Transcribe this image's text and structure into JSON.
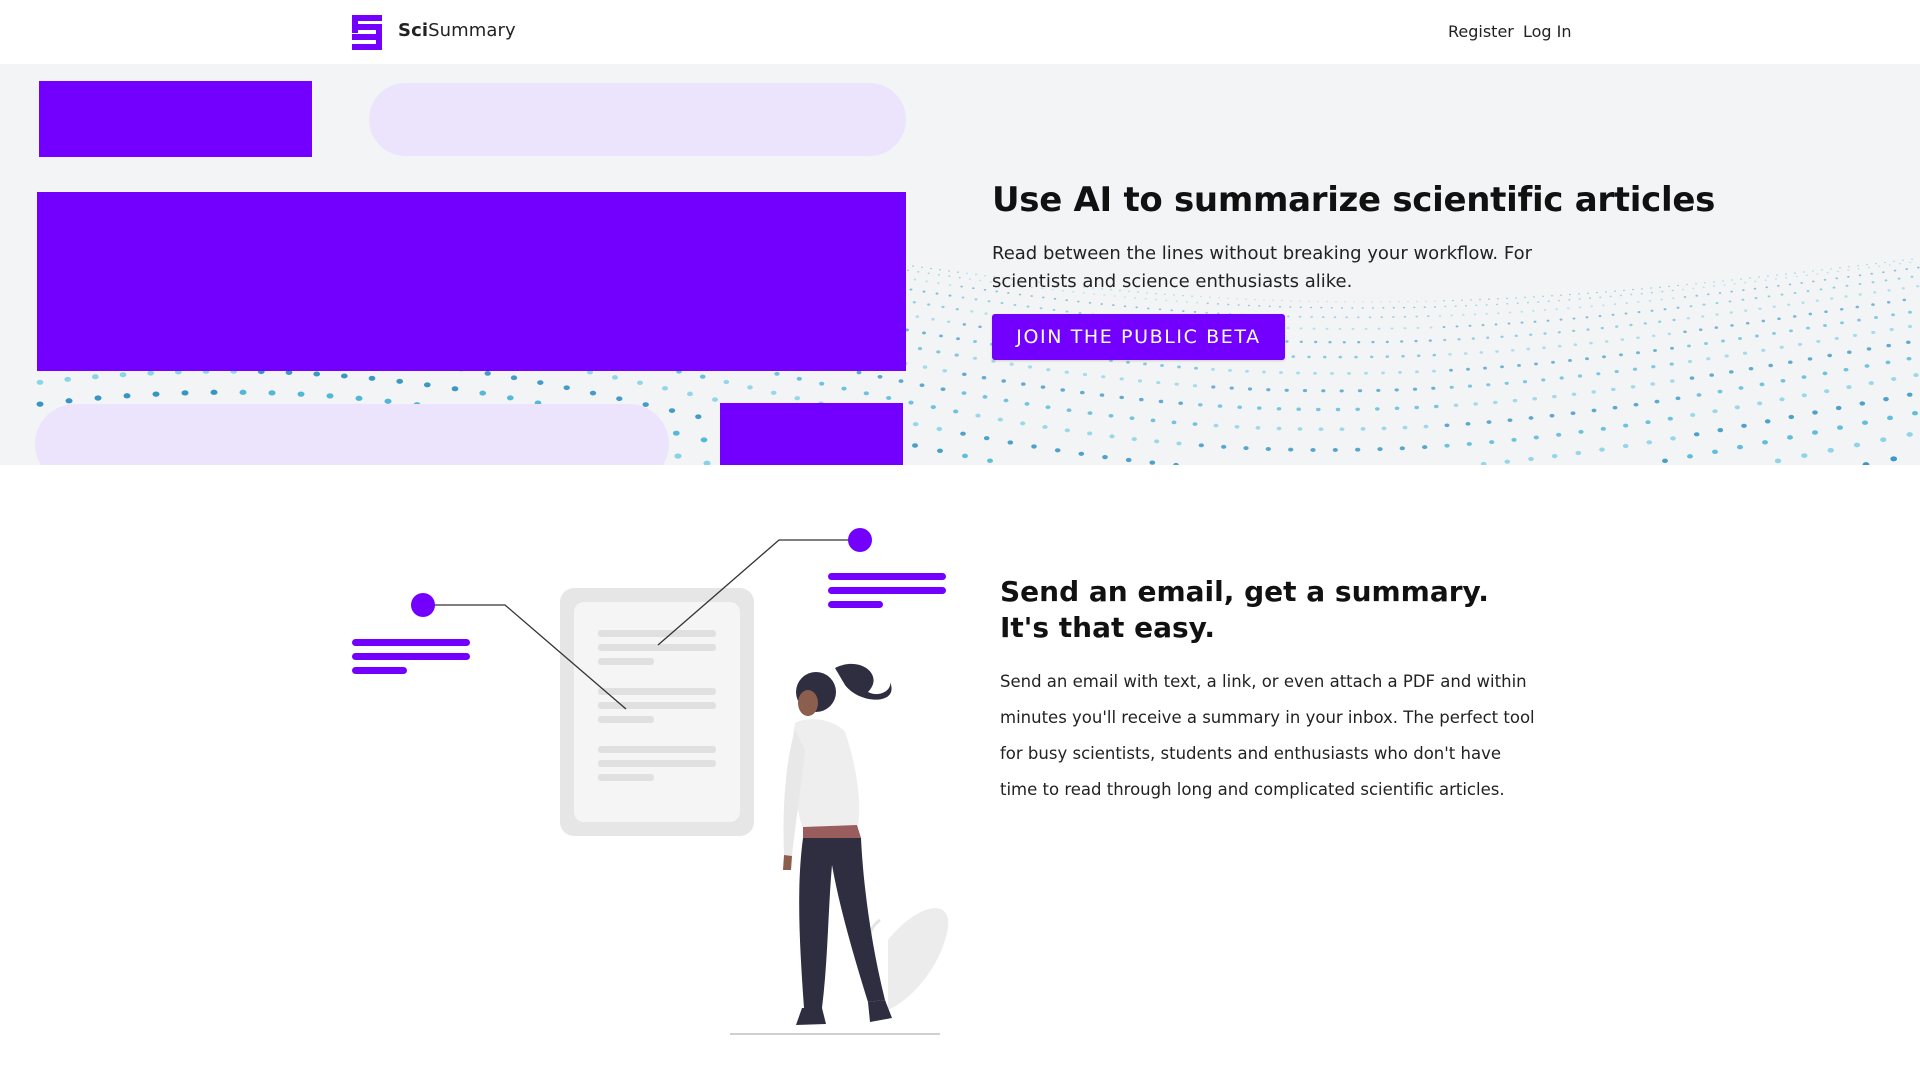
{
  "nav": {
    "brand_bold": "Sci",
    "brand_rest": "Summary",
    "register_label": "Register",
    "login_label": "Log In"
  },
  "hero": {
    "title": "Use AI to summarize scientific articles",
    "subtitle": "Read between the lines without breaking your workflow. For scientists and science enthusiasts alike.",
    "cta_label": "JOIN THE PUBLIC BETA"
  },
  "feature": {
    "title": "Send an email, get a summary. It's that easy.",
    "text": "Send an email with text, a link, or even attach a PDF and within minutes you'll receive a summary in your inbox. The perfect tool for busy scientists, students and enthusiasts who don't have time to read through long and complicated scientific articles."
  },
  "colors": {
    "accent": "#7300ff",
    "accent_light": "#ece3fd",
    "hero_bg": "#f3f4f6",
    "dots": "#2a8fc0"
  },
  "icons": {
    "logo": "scisummary-logo-icon",
    "illustration": "woman-reading-document-illustration"
  }
}
